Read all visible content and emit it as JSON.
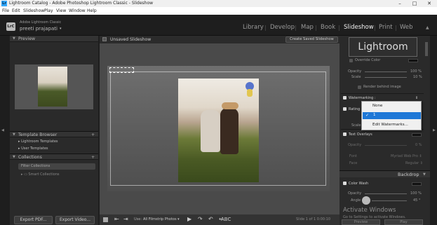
{
  "window": {
    "title": "Lightroom Catalog - Adobe Photoshop Lightroom Classic - Slideshow",
    "app_icon": "Lr",
    "controls": [
      "–",
      "□",
      "✕"
    ]
  },
  "menu": [
    "File",
    "Edit",
    "Slideshow",
    "Play",
    "View",
    "Window",
    "Help"
  ],
  "identity": {
    "badge": "LrC",
    "product": "Adobe Lightroom Classic",
    "user": "preeti prajapati",
    "user_caret": "▾"
  },
  "modules": [
    "Library",
    "Develop",
    "Map",
    "Book",
    "Slideshow",
    "Print",
    "Web"
  ],
  "active_module": "Slideshow",
  "left_panel": {
    "preview_title": "Preview",
    "template_browser_title": "Template Browser",
    "templates": [
      "Lightroom Templates",
      "User Templates"
    ],
    "collections_title": "Collections",
    "filter_collections": "Filter Collections",
    "smart_collections": "Smart Collections",
    "export_pdf": "Export PDF...",
    "export_video": "Export Video..."
  },
  "center": {
    "doc_title": "Unsaved Slideshow",
    "create_saved": "Create Saved Slideshow",
    "toolbar": {
      "use_label": "Use:",
      "use_value": "All Filmstrip Photos",
      "abc": "ABC",
      "slide_status": "Slide 1 of 1   0:00:10"
    }
  },
  "right_panel": {
    "identity_plate_text": "Lightroom",
    "override_color": "Override Color",
    "opacity_label": "Opacity",
    "opacity_value": "100 %",
    "scale_label": "Scale",
    "scale_value": "10 %",
    "render_behind": "Render behind image",
    "watermarking": "Watermarking :",
    "rating_label": "Rating",
    "scale_label2": "Scale",
    "text_overlays": "Text Overlays",
    "opacity_value2": "0 %",
    "font_label": "Font",
    "font_value": "Myriad Web Pro",
    "face_label": "Face",
    "face_value": "Regular",
    "backdrop_title": "Backdrop",
    "color_wash": "Color Wash",
    "opacity3": "100 %",
    "angle_label": "Angle",
    "angle_value": "45 °"
  },
  "watermark_dropdown": {
    "options": [
      "None",
      "1",
      "Edit Watermarks..."
    ],
    "selected": "1"
  },
  "activate": {
    "title": "Activate Windows",
    "body": "Go to Settings to activate Windows."
  },
  "bottom_right": [
    "Preview",
    "Play"
  ],
  "colors": {
    "active_module": "#e8e8e8",
    "selection_blue": "#1e78d7",
    "accent": "#31a8ff"
  }
}
